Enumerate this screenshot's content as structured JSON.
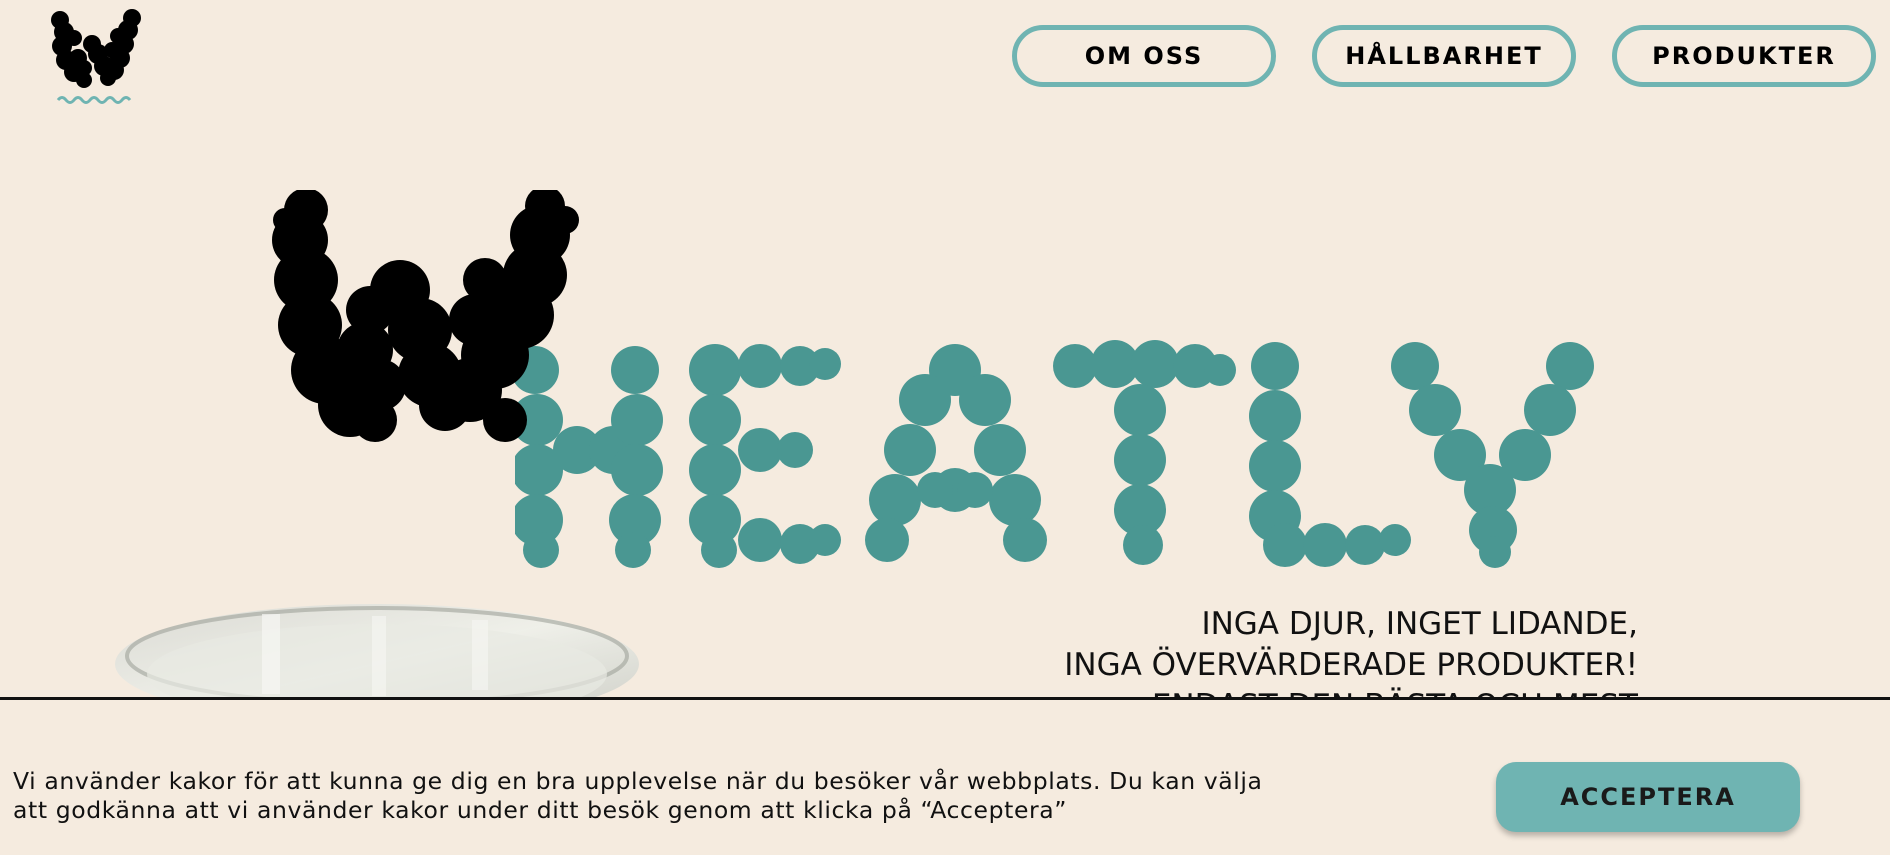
{
  "colors": {
    "background": "#f5ebdf",
    "accent": "#6fb4b2",
    "hero_teal": "#4a9792",
    "text": "#111111"
  },
  "nav": {
    "items": [
      {
        "label": "OM  OSS"
      },
      {
        "label": "HÅLLBARHET"
      },
      {
        "label": "PRODUKTER"
      }
    ]
  },
  "hero": {
    "logo_letters": "WHEATLY",
    "tagline": [
      "INGA DJUR, INGET LIDANDE,",
      "INGA ÖVERVÄRDERADE PRODUKTER!",
      "ENDAST DEN BÄSTA OCH MEST"
    ]
  },
  "cookie": {
    "text_line1": "Vi använder kakor för att kunna ge dig en bra upplevelse när du besöker vår webbplats. Du kan välja",
    "text_line2": "att godkänna att vi använder kakor under ditt besök genom att klicka på “Acceptera”",
    "accept_label": "ACCEPTERA"
  }
}
